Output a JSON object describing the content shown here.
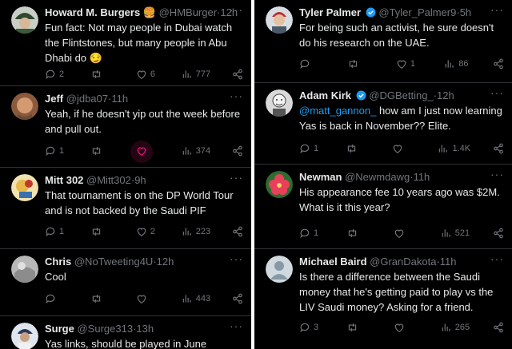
{
  "left": [
    {
      "name": "Howard M. Burgers 🍔",
      "handle": "@HMBurger",
      "time": "12h",
      "text": "Fun fact: Not may people in Dubai watch the Flintstones, but many people in Abu Dhabi do 😏",
      "replies": "2",
      "retweets": "",
      "likes": "6",
      "views": "777",
      "avatar": "cap"
    },
    {
      "name": "Jeff",
      "handle": "@jdba07",
      "time": "11h",
      "text": "Yeah, if he doesn't yip out the week before and pull out.",
      "replies": "1",
      "retweets": "",
      "likes": "",
      "views": "374",
      "avatar": "face"
    },
    {
      "name": "Mitt 302",
      "handle": "@Mitt302",
      "time": "9h",
      "text": "That tournament is on the DP World Tour and is not backed by the Saudi PIF",
      "replies": "1",
      "retweets": "",
      "likes": "2",
      "views": "223",
      "avatar": "cartoon"
    },
    {
      "name": "Chris",
      "handle": "@NoTweeting4U",
      "time": "12h",
      "text": "Cool",
      "replies": "",
      "retweets": "",
      "likes": "",
      "views": "443",
      "avatar": "gray"
    },
    {
      "name": "Surge",
      "handle": "@Surge313",
      "time": "13h",
      "text": "Yas links, should be played in June",
      "replies": "",
      "retweets": "",
      "likes": "",
      "views": "",
      "avatar": "golfer"
    }
  ],
  "right": [
    {
      "name": "Tyler Palmer",
      "handle": "@Tyler_Palmer9",
      "time": "5h",
      "text": "For being such an activist, he sure doesn't do his research on the UAE.",
      "replies": "",
      "retweets": "",
      "likes": "1",
      "views": "86",
      "avatar": "tyler"
    },
    {
      "name": "Adam Kirk",
      "handle": "@DGBetting_",
      "time": "12h",
      "mention": "@matt_gannon_",
      "text": " how am I just now learning Yas is back in November?? Elite.",
      "replies": "1",
      "retweets": "",
      "likes": "",
      "views": "1.4K",
      "avatar": "adam"
    },
    {
      "name": "Newman",
      "handle": "@Newmdawg",
      "time": "11h",
      "text": "His appearance fee 10 years ago was $2M. What is it this year?",
      "replies": "1",
      "retweets": "",
      "likes": "",
      "views": "521",
      "avatar": "flower"
    },
    {
      "name": "Michael Baird",
      "handle": "@GranDakota",
      "time": "11h",
      "text": "Is there a difference between the Saudi money that he's getting paid to play vs the LIV Saudi money? Asking for a friend.",
      "replies": "3",
      "retweets": "",
      "likes": "",
      "views": "265",
      "avatar": "default"
    }
  ],
  "ui": {
    "dot": "·",
    "more": "···"
  },
  "colors": {
    "accent": "#1d9bf0",
    "muted": "#71767b",
    "text": "#e7e9ea",
    "like": "#f91880",
    "bg": "#000000"
  }
}
